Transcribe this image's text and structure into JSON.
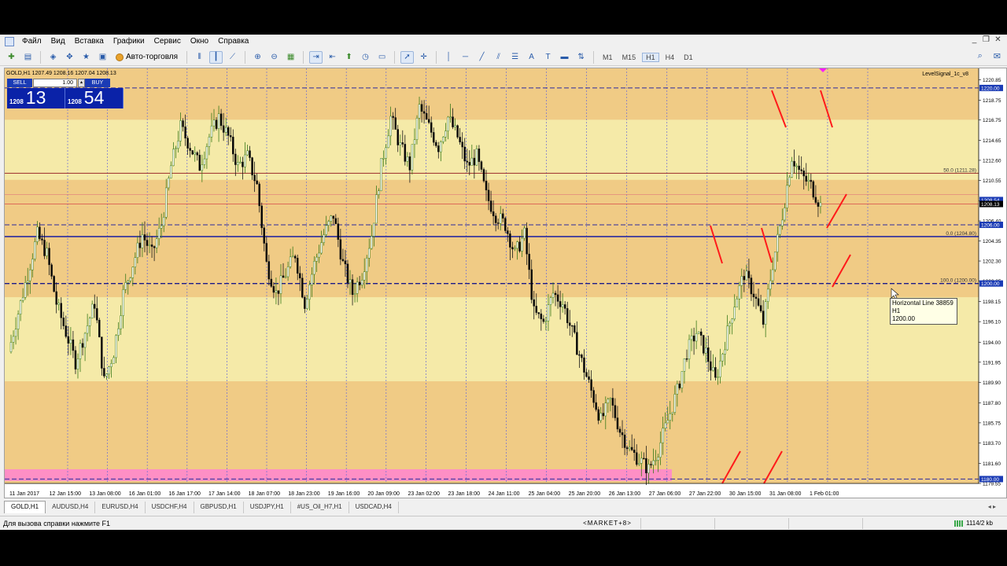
{
  "menu": {
    "items": [
      "Файл",
      "Вид",
      "Вставка",
      "Графики",
      "Сервис",
      "Окно",
      "Справка"
    ]
  },
  "toolbar": {
    "autotrade_label": "Авто-торговля",
    "timeframes": [
      "M1",
      "M15",
      "H1",
      "H4",
      "D1"
    ],
    "selected_timeframe": "H1"
  },
  "chart": {
    "title": "GOLD,H1  1207.49  1208.16  1207.04  1208.13",
    "indicator_label": "LevelSignal_1c_v8",
    "one_click": {
      "sell_label": "SELL",
      "buy_label": "BUY",
      "lot": "1.00",
      "sell_small": "1208",
      "sell_big": "13",
      "buy_small": "1208",
      "buy_big": "54"
    },
    "fib_labels": [
      "50.0 (1211.28)",
      "0.0 (1204.80)",
      "100.0 (1200.00)"
    ],
    "price_ticks": [
      "1220.85",
      "1218.75",
      "1216.75",
      "1214.65",
      "1212.60",
      "1210.55",
      "1208.45",
      "1206.40",
      "1204.35",
      "1202.30",
      "1200.25",
      "1198.15",
      "1196.10",
      "1194.00",
      "1191.95",
      "1189.90",
      "1187.80",
      "1185.75",
      "1183.70",
      "1181.60",
      "1179.55"
    ],
    "price_highlights": [
      {
        "price": 1220.0,
        "label": "1220.00",
        "color": "#1a3bb5"
      },
      {
        "price": 1208.54,
        "label": "1208.54",
        "color": "#1a3bb5"
      },
      {
        "price": 1208.13,
        "label": "1208.13",
        "color": "#000000"
      },
      {
        "price": 1206.0,
        "label": "1206.00",
        "color": "#1a3bb5"
      },
      {
        "price": 1200.0,
        "label": "1200.00",
        "color": "#1a3bb5"
      },
      {
        "price": 1180.0,
        "label": "1180.00",
        "color": "#1a3bb5"
      }
    ],
    "time_labels": [
      "11 Jan 2017",
      "12 Jan 15:00",
      "13 Jan 08:00",
      "16 Jan 01:00",
      "16 Jan 17:00",
      "17 Jan 14:00",
      "18 Jan 07:00",
      "18 Jan 23:00",
      "19 Jan 16:00",
      "20 Jan 09:00",
      "23 Jan 02:00",
      "23 Jan 18:00",
      "24 Jan 11:00",
      "25 Jan 04:00",
      "25 Jan 20:00",
      "26 Jan 13:00",
      "27 Jan 06:00",
      "27 Jan 22:00",
      "30 Jan 15:00",
      "31 Jan 08:00",
      "1 Feb 01:00"
    ],
    "tooltip": {
      "line1": "Horizontal Line 38859",
      "line2": "H1",
      "line3": "1200.00"
    }
  },
  "chart_data": {
    "type": "candlestick",
    "symbol": "GOLD",
    "timeframe": "H1",
    "ylim": [
      1179.55,
      1222.0
    ],
    "horizontal_levels": [
      1220.0,
      1211.28,
      1206.0,
      1204.8,
      1200.0,
      1180.0
    ],
    "zones": [
      {
        "from": 1216.75,
        "to": 1222.0,
        "color": "#edc07a"
      },
      {
        "from": 1198.6,
        "to": 1210.6,
        "color": "#edc07a"
      },
      {
        "from": 1179.55,
        "to": 1190.0,
        "color": "#edc07a"
      },
      {
        "from": 1179.8,
        "to": 1181.0,
        "color": "#ff88cc"
      }
    ],
    "close_path": [
      1193,
      1197,
      1201,
      1205,
      1203,
      1198,
      1195,
      1192,
      1195,
      1198,
      1190,
      1193,
      1199,
      1202,
      1205,
      1203,
      1206,
      1212,
      1216,
      1214,
      1212,
      1215,
      1217,
      1215,
      1212,
      1213,
      1210,
      1202,
      1199,
      1201,
      1203,
      1198,
      1202,
      1205,
      1207,
      1202,
      1199,
      1201,
      1205,
      1212,
      1217,
      1214,
      1212,
      1218,
      1216,
      1214,
      1217,
      1215,
      1212,
      1213,
      1209,
      1207,
      1206,
      1203,
      1205,
      1197,
      1196,
      1199,
      1198,
      1195,
      1192,
      1189,
      1186,
      1188,
      1185,
      1183,
      1182,
      1181,
      1183,
      1186,
      1189,
      1193,
      1195,
      1193,
      1190,
      1194,
      1198,
      1201,
      1199,
      1196,
      1202,
      1207,
      1213,
      1211,
      1210,
      1208
    ]
  },
  "tabs": [
    "GOLD,H1",
    "AUDUSD,H4",
    "EURUSD,H4",
    "USDCHF,H4",
    "GBPUSD,H1",
    "USDJPY,H1",
    "#US_Oil_H7,H1",
    "USDCAD,H4"
  ],
  "status": {
    "help": "Для вызова справки нажмите F1",
    "profile": "<MARKET+8>",
    "traffic": "1114/2 kb"
  }
}
